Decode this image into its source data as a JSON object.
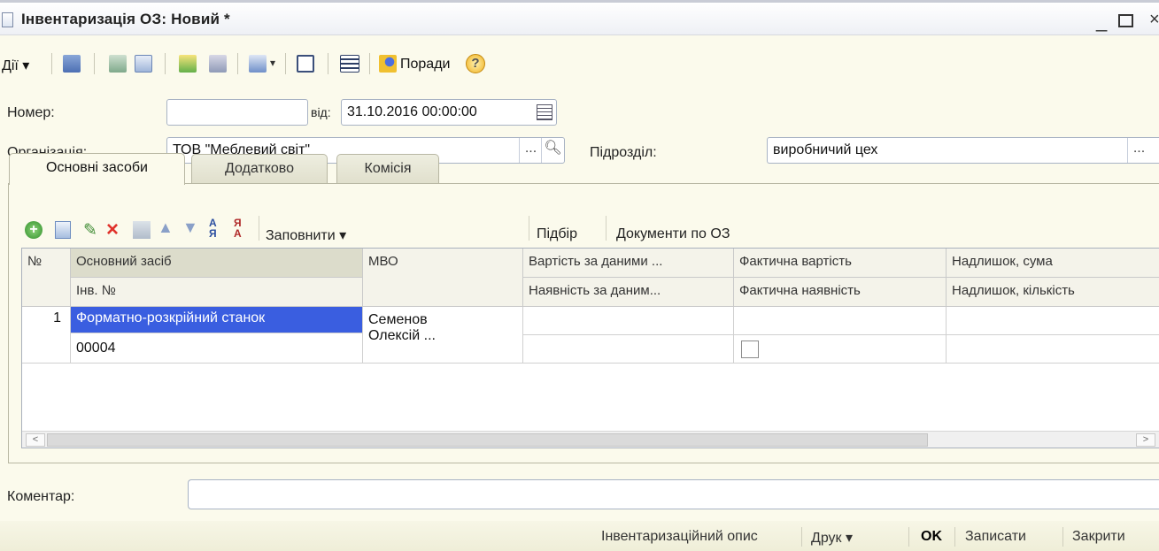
{
  "window": {
    "title": "Інвентаризація ОЗ: Новий *"
  },
  "toolbar": {
    "actions_label": "Дії",
    "tips_label": "Поради"
  },
  "header": {
    "number_label": "Номер:",
    "number_value": "",
    "date_label": "від:",
    "date_value": "31.10.2016 00:00:00",
    "org_label": "Організація:",
    "org_value": "ТОВ \"Меблевий світ\"",
    "dept_label": "Підрозділ:",
    "dept_value": "виробничий цех"
  },
  "tabs": [
    {
      "label": "Основні засоби"
    },
    {
      "label": "Додатково"
    },
    {
      "label": "Комісія"
    }
  ],
  "commands": {
    "fill_label": "Заповнити",
    "select_label": "Підбір",
    "docs_label": "Документи по ОЗ"
  },
  "grid": {
    "headers_row1": [
      "№",
      "Основний засіб",
      "МВО",
      "Вартість за даними ...",
      "Фактична вартість",
      "Надлишок, сума"
    ],
    "headers_row2": [
      "Інв. №",
      "Наявність за даним...",
      "Фактична наявність",
      "Надлишок, кількість"
    ],
    "rows": [
      {
        "num": "1",
        "asset": "Форматно-розкрійний станок",
        "inv": "00004",
        "mvo_line1": "Семенов",
        "mvo_line2": "Олексій ..."
      }
    ]
  },
  "comment": {
    "label": "Коментар:",
    "value": ""
  },
  "footer": {
    "inventory_label": "Інвентаризаційний опис",
    "print_label": "Друк",
    "ok_label": "OK",
    "save_label": "Записати",
    "close_label": "Закрити"
  },
  "colors": {
    "background": "#fbfaec",
    "selection": "#3a5ee0",
    "header": "#f4f3ea",
    "ok_text": "#000000"
  },
  "icons": [
    "window-icon",
    "minimize-icon",
    "maximize-icon",
    "close-icon",
    "add-icon",
    "copy-icon",
    "edit-icon",
    "delete-icon",
    "calendar-icon",
    "search-icon",
    "help-icon"
  ]
}
